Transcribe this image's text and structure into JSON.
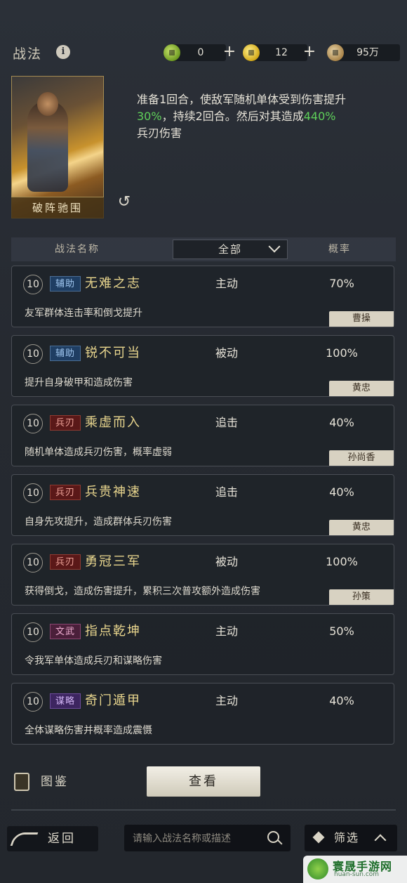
{
  "header": {
    "title": "战法",
    "info_icon": "info-icon",
    "resources": [
      {
        "icon": "jade-coin-icon",
        "value": "0"
      },
      {
        "icon": "gold-coin-icon",
        "value": "12"
      },
      {
        "icon": "copper-coin-icon",
        "value": "95万"
      }
    ],
    "plus_label": "+"
  },
  "skill": {
    "card_name": "破阵驰围",
    "desc_pre": "准备1回合，使敌军随机单体受到伤害提升",
    "desc_pct1": "30%",
    "desc_mid": "，持续2回合。然后对其造成",
    "desc_pct2": "440%",
    "desc_post": "兵刃伤害",
    "highlight_color": "#5fd05a"
  },
  "table_header": {
    "name_col": "战法名称",
    "filter_value": "全部",
    "rate_col": "概率"
  },
  "rows": [
    {
      "level": "10",
      "tag": "辅助",
      "tag_type": "fz",
      "name": "无难之志",
      "type": "主动",
      "rate": "70%",
      "desc": "友军群体连击率和倒戈提升",
      "hero": "曹操"
    },
    {
      "level": "10",
      "tag": "辅助",
      "tag_type": "fz",
      "name": "锐不可当",
      "type": "被动",
      "rate": "100%",
      "desc": "提升自身破甲和造成伤害",
      "hero": "黄忠"
    },
    {
      "level": "10",
      "tag": "兵刃",
      "tag_type": "br",
      "name": "乘虚而入",
      "type": "追击",
      "rate": "40%",
      "desc": "随机单体造成兵刃伤害，概率虚弱",
      "hero": "孙尚香"
    },
    {
      "level": "10",
      "tag": "兵刃",
      "tag_type": "br",
      "name": "兵贵神速",
      "type": "追击",
      "rate": "40%",
      "desc": "自身先攻提升，造成群体兵刃伤害",
      "hero": "黄忠"
    },
    {
      "level": "10",
      "tag": "兵刃",
      "tag_type": "br",
      "name": "勇冠三军",
      "type": "被动",
      "rate": "100%",
      "desc": "获得倒戈，造成伤害提升，累积三次普攻额外造成伤害",
      "hero": "孙策"
    },
    {
      "level": "10",
      "tag": "文武",
      "tag_type": "ww",
      "name": "指点乾坤",
      "type": "主动",
      "rate": "50%",
      "desc": "令我军单体造成兵刃和谋略伤害",
      "hero": ""
    },
    {
      "level": "10",
      "tag": "谋略",
      "tag_type": "ml",
      "name": "奇门遁甲",
      "type": "主动",
      "rate": "40%",
      "desc": "全体谋略伤害并概率造成震慑",
      "hero": ""
    }
  ],
  "footer": {
    "atlas_label": "图鉴",
    "view_label": "查看",
    "back_label": "返回",
    "search_placeholder": "请输入战法名称或描述",
    "filter_label": "筛选"
  },
  "watermark": {
    "text": "寰晟手游网",
    "sub": "huan-sun.com"
  }
}
